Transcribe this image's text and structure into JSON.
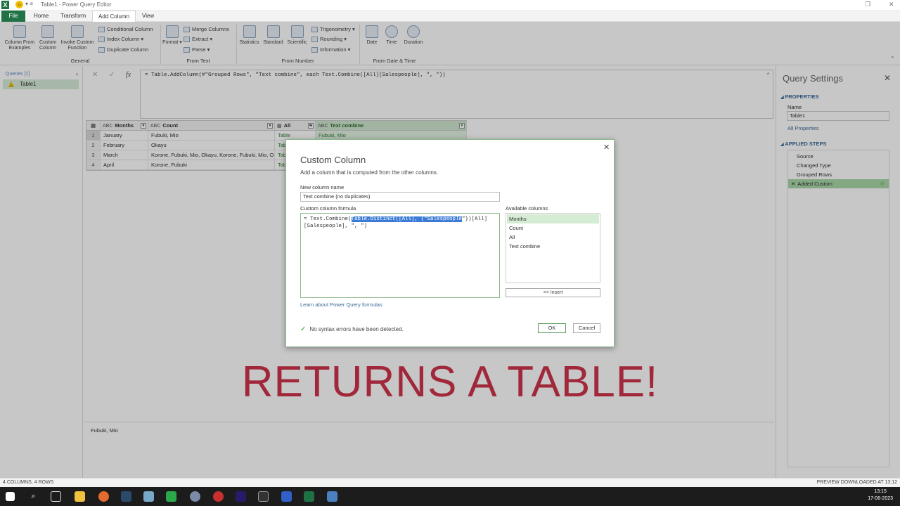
{
  "window": {
    "title": "Table1 - Power Query Editor"
  },
  "ribbon": {
    "tabs": [
      "File",
      "Home",
      "Transform",
      "Add Column",
      "View"
    ],
    "active_tab": "Add Column",
    "general": {
      "column_from_examples": "Column From Examples",
      "custom_column": "Custom Column",
      "invoke_custom_function": "Invoke Custom Function",
      "conditional_column": "Conditional Column",
      "index_column": "Index Column",
      "duplicate_column": "Duplicate Column",
      "label": "General"
    },
    "from_text": {
      "format": "Format",
      "merge_columns": "Merge Columns",
      "extract": "Extract",
      "parse": "Parse",
      "label": "From Text"
    },
    "from_number": {
      "statistics": "Statistics",
      "standard": "Standard",
      "scientific": "Scientific",
      "trigonometry": "Trigonometry",
      "rounding": "Rounding",
      "information": "Information",
      "label": "From Number"
    },
    "from_datetime": {
      "date": "Date",
      "time": "Time",
      "duration": "Duration",
      "label": "From Date & Time"
    }
  },
  "queries": {
    "header": "Queries [1]",
    "items": [
      "Table1"
    ]
  },
  "formula_bar": {
    "text": "= Table.AddColumn(#\"Grouped Rows\", \"Text combine\", each Text.Combine([All][Salespeople], \", \"))"
  },
  "grid": {
    "headers": [
      "Months",
      "Count",
      "All",
      "Text combine"
    ],
    "rows": [
      {
        "n": "1",
        "months": "January",
        "count": "Fubuki, Mio",
        "all": "Table",
        "text": "Fubuki, Mio"
      },
      {
        "n": "2",
        "months": "February",
        "count": "Okayu",
        "all": "Tab",
        "text": ""
      },
      {
        "n": "3",
        "months": "March",
        "count": "Korone, Fubuki, Mio, Okayu, Korone, Fubuki, Mio, O...",
        "all": "Tab",
        "text": ""
      },
      {
        "n": "4",
        "months": "April",
        "count": "Korone, Fubuki",
        "all": "Tab",
        "text": ""
      }
    ]
  },
  "preview": {
    "value": "Fubuki, Mio"
  },
  "query_settings": {
    "title": "Query Settings",
    "properties": "PROPERTIES",
    "name_label": "Name",
    "name_value": "Table1",
    "all_properties": "All Properties",
    "applied_steps": "APPLIED STEPS",
    "steps": [
      "Source",
      "Changed Type",
      "Grouped Rows",
      "Added Custom"
    ]
  },
  "dialog": {
    "title": "Custom Column",
    "subtitle": "Add a column that is computed from the other columns.",
    "new_column_label": "New column name",
    "new_column_value": "Text combine (no duplicates)",
    "formula_label": "Custom column formula",
    "formula_pre": "= Text.Combine(",
    "formula_hl": "Table.Distinct([All], {\"Salespeople",
    "formula_post": "\"})[All]",
    "formula_line2": "[Salespeople], \", \")",
    "available_label": "Available columns",
    "available": [
      "Months",
      "Count",
      "All",
      "Text combine"
    ],
    "insert": "<< Insert",
    "learn": "Learn about Power Query formulas",
    "status": "No syntax errors have been detected.",
    "ok": "OK",
    "cancel": "Cancel"
  },
  "overlay_text": "RETURNS A TABLE!",
  "status_bar": {
    "left": "4 COLUMNS, 4 ROWS",
    "right": "PREVIEW DOWNLOADED AT 13:12"
  },
  "taskbar": {
    "time": "13:15",
    "date": "17-06-2023"
  },
  "colors": {
    "accent": "#217346",
    "overlay": "#a0283a",
    "selection": "#3b7bd6"
  }
}
